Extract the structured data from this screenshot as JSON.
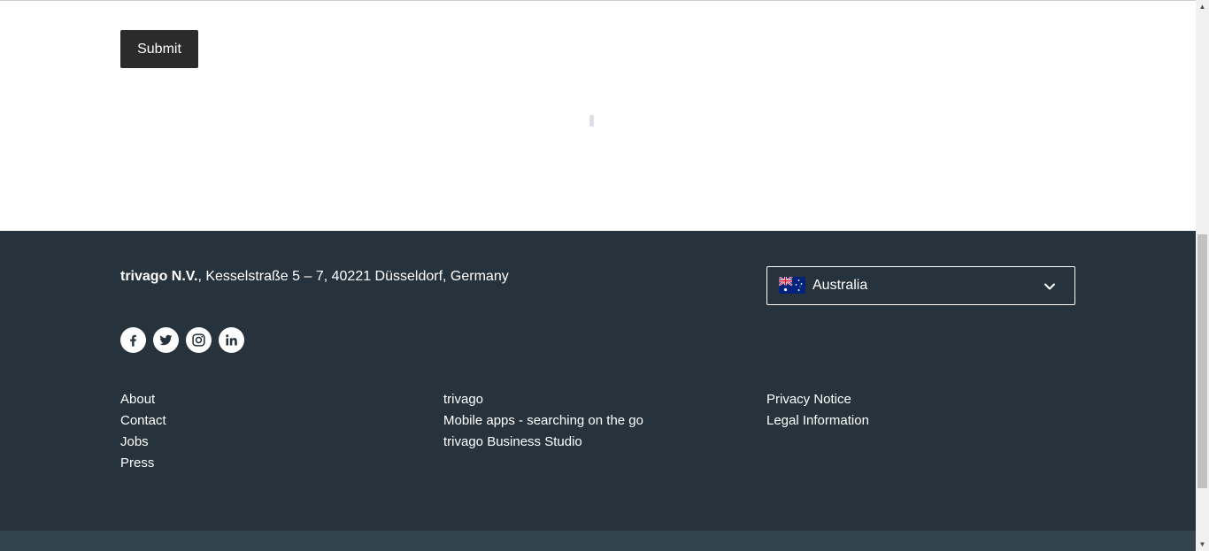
{
  "form": {
    "submit_label": "Submit"
  },
  "footer": {
    "company_name": "trivago N.V.",
    "company_address": ", Kesselstraße 5 – 7, 40221 Düsseldorf, Germany",
    "country_select": {
      "selected": "Australia",
      "flag_icon": "australia-flag-icon"
    },
    "social_icons": [
      "facebook-icon",
      "twitter-icon",
      "instagram-icon",
      "linkedin-icon"
    ],
    "link_columns": [
      [
        "About",
        "Contact",
        "Jobs",
        "Press"
      ],
      [
        "trivago",
        "Mobile apps - searching on the go",
        "trivago Business Studio"
      ],
      [
        "Privacy Notice",
        "Legal Information"
      ]
    ]
  },
  "colors": {
    "footer_bg": "#27333c",
    "footer_bottom_bg": "#33434d",
    "button_bg": "#2b2b2b"
  }
}
